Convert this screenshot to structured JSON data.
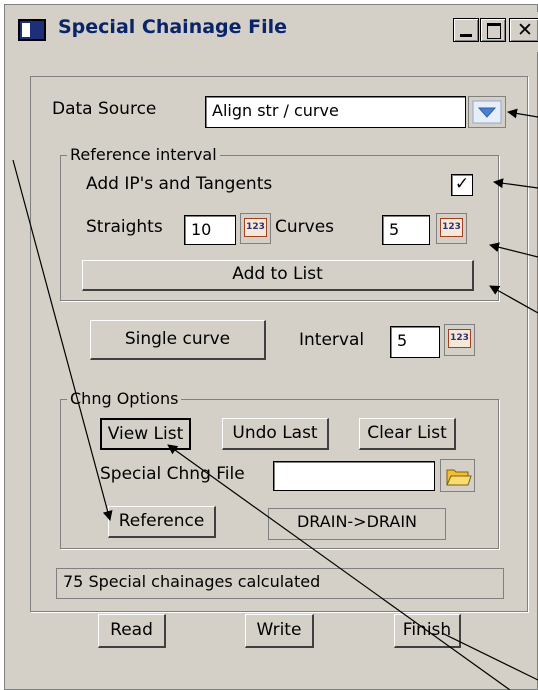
{
  "window": {
    "title": "Special Chainage File"
  },
  "data_source": {
    "label": "Data Source",
    "value": "Align str / curve"
  },
  "reference_interval": {
    "legend": "Reference interval",
    "add_ip_label": "Add IP's and Tangents",
    "add_ip_checked": true,
    "straights_label": "Straights",
    "straights_value": "10",
    "curves_label": "Curves",
    "curves_value": "5",
    "add_to_list_label": "Add to List"
  },
  "single_curve": {
    "button_label": "Single curve",
    "interval_label": "Interval",
    "interval_value": "5"
  },
  "chng_options": {
    "legend": "Chng Options",
    "view_list_label": "View List",
    "undo_last_label": "Undo Last",
    "clear_list_label": "Clear List",
    "special_file_label": "Special Chng File",
    "special_file_value": "",
    "reference_label": "Reference",
    "reference_value": "DRAIN->DRAIN"
  },
  "status": {
    "message": "75 Special chainages calculated"
  },
  "footer": {
    "read_label": "Read",
    "write_label": "Write",
    "finish_label": "Finish"
  },
  "icons": {
    "number_button": "123",
    "folder": "folder-icon",
    "dropdown": "chevron-down-icon"
  },
  "colors": {
    "title_text": "#0a246a",
    "dialog_bg": "#d4d0c8",
    "dropdown_arrow": "#4a7fd0",
    "folder": "#f0c030"
  }
}
